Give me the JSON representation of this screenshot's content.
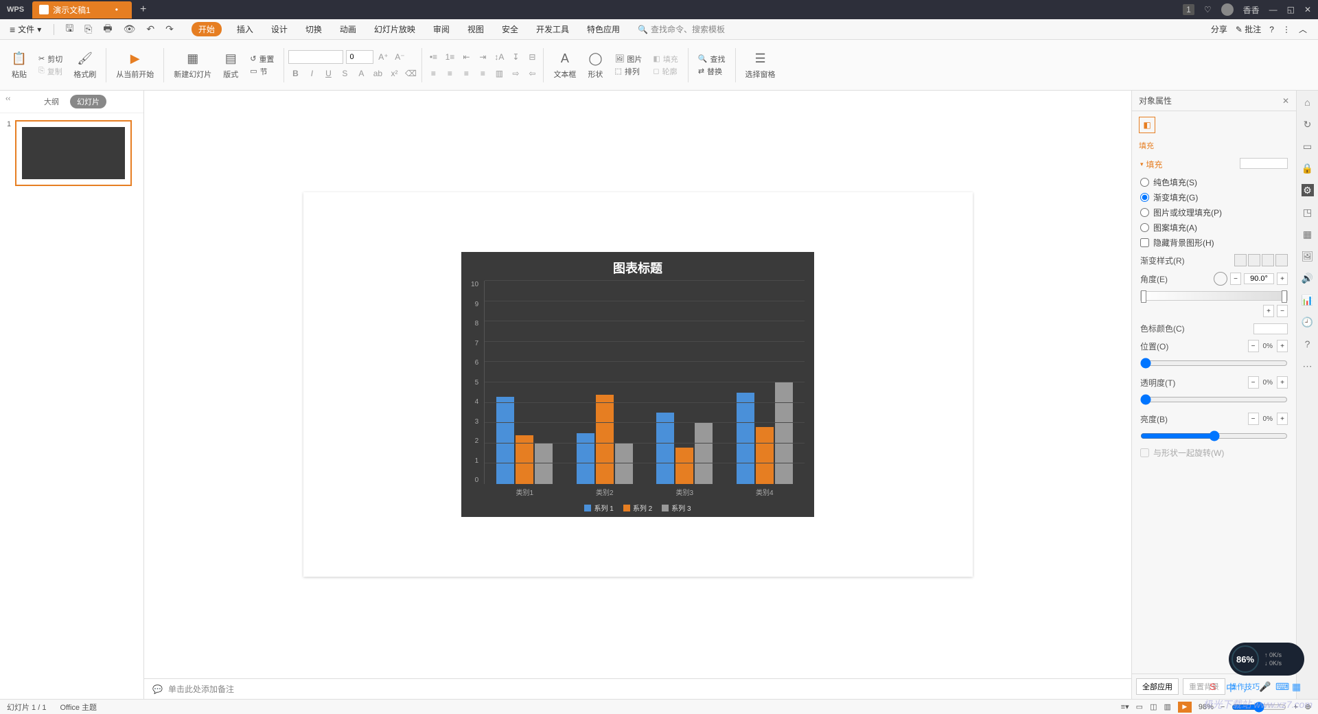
{
  "titlebar": {
    "logo": "WPS",
    "doc_tab": "演示文稿1",
    "user": "香香",
    "badge": "1"
  },
  "menubar": {
    "file": "文件",
    "tabs": [
      "开始",
      "插入",
      "设计",
      "切换",
      "动画",
      "幻灯片放映",
      "审阅",
      "视图",
      "安全",
      "开发工具",
      "特色应用"
    ],
    "active_tab": 0,
    "search_placeholder": "查找命令、搜索模板",
    "share": "分享",
    "annotate": "批注"
  },
  "ribbon": {
    "paste": "粘贴",
    "cut": "剪切",
    "copy": "复制",
    "format_painter": "格式刷",
    "play_from": "从当前开始",
    "new_slide": "新建幻灯片",
    "layout": "版式",
    "reset": "重置",
    "section": "节",
    "font_size": "0",
    "textbox": "文本框",
    "shapes": "形状",
    "picture": "图片",
    "arrange": "排列",
    "fill": "填充",
    "outline": "轮廓",
    "find": "查找",
    "replace": "替换",
    "select_pane": "选择窗格"
  },
  "slide_panel": {
    "outline": "大纲",
    "slides": "幻灯片",
    "slide_num": "1"
  },
  "notes": {
    "placeholder": "单击此处添加备注"
  },
  "prop_panel": {
    "title": "对象属性",
    "fill_tab": "填充",
    "section_fill": "填充",
    "solid_fill": "纯色填充(S)",
    "gradient_fill": "渐变填充(G)",
    "picture_fill": "图片或纹理填充(P)",
    "pattern_fill": "图案填充(A)",
    "hide_bg": "隐藏背景图形(H)",
    "gradient_style": "渐变样式(R)",
    "angle": "角度(E)",
    "angle_value": "90.0°",
    "stop_color": "色标颜色(C)",
    "position": "位置(O)",
    "position_value": "0%",
    "transparency": "透明度(T)",
    "transparency_value": "0%",
    "brightness": "亮度(B)",
    "brightness_value": "0%",
    "rotate_with_shape": "与形状一起旋转(W)",
    "all_apps": "全部应用",
    "reset_bg": "重置背景",
    "tips": "操作技巧"
  },
  "statusbar": {
    "slide_info": "幻灯片 1 / 1",
    "theme": "Office 主题",
    "zoom": "98%"
  },
  "floating": {
    "percent": "86%",
    "up": "0K/s",
    "down": "0K/s"
  },
  "watermark": "极光下载站 www.xz7.com",
  "chart_data": {
    "type": "bar",
    "title": "图表标题",
    "categories": [
      "类别1",
      "类别2",
      "类别3",
      "类别4"
    ],
    "series": [
      {
        "name": "系列 1",
        "values": [
          4.3,
          2.5,
          3.5,
          4.5
        ],
        "color": "#4a90d9"
      },
      {
        "name": "系列 2",
        "values": [
          2.4,
          4.4,
          1.8,
          2.8
        ],
        "color": "#e67e22"
      },
      {
        "name": "系列 3",
        "values": [
          2.0,
          2.0,
          3.0,
          5.0
        ],
        "color": "#999999"
      }
    ],
    "ylim": [
      0,
      10
    ],
    "yticks": [
      0,
      1,
      2,
      3,
      4,
      5,
      6,
      7,
      8,
      9,
      10
    ]
  }
}
